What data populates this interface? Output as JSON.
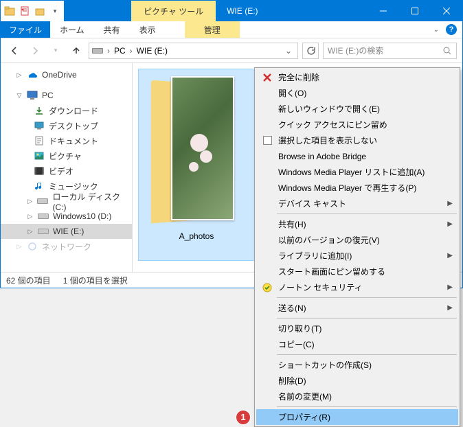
{
  "titlebar": {
    "tool_tab": "ピクチャ ツール",
    "title": "WIE (E:)"
  },
  "ribbon": {
    "file": "ファイル",
    "home": "ホーム",
    "share": "共有",
    "view": "表示",
    "manage": "管理"
  },
  "breadcrumb": {
    "pc": "PC",
    "drive": "WIE (E:)"
  },
  "search": {
    "placeholder": "WIE (E:)の検索"
  },
  "tree": {
    "onedrive": "OneDrive",
    "pc": "PC",
    "downloads": "ダウンロード",
    "desktop": "デスクトップ",
    "documents": "ドキュメント",
    "pictures": "ピクチャ",
    "videos": "ビデオ",
    "music": "ミュージック",
    "localc": "ローカル ディスク (C:)",
    "win10d": "Windows10 (D:)",
    "wiee": "WIE (E:)",
    "network": "ネットワーク"
  },
  "content": {
    "folder_name": "A_photos"
  },
  "status": {
    "count": "62 個の項目",
    "selected": "1 個の項目を選択"
  },
  "menu": {
    "delete_full": "完全に削除",
    "open": "開く(O)",
    "open_new": "新しいウィンドウで開く(E)",
    "pin_quick": "クイック アクセスにピン留め",
    "hide_selected": "選択した項目を表示しない",
    "bridge": "Browse in Adobe Bridge",
    "wmp_add": "Windows Media Player リストに追加(A)",
    "wmp_play": "Windows Media Player で再生する(P)",
    "cast": "デバイス キャスト",
    "share": "共有(H)",
    "restore_prev": "以前のバージョンの復元(V)",
    "library": "ライブラリに追加(I)",
    "pin_start": "スタート画面にピン留めする",
    "norton": "ノートン セキュリティ",
    "send_to": "送る(N)",
    "cut": "切り取り(T)",
    "copy": "コピー(C)",
    "shortcut": "ショートカットの作成(S)",
    "delete": "削除(D)",
    "rename": "名前の変更(M)",
    "properties": "プロパティ(R)",
    "badge": "1"
  }
}
